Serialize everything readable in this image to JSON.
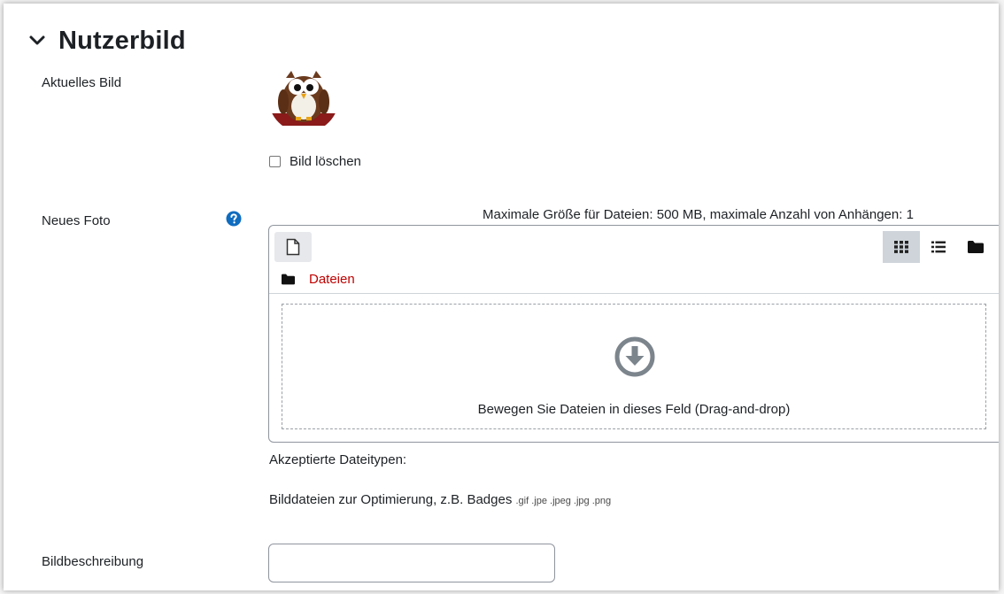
{
  "section": {
    "title": "Nutzerbild"
  },
  "current_image": {
    "label": "Aktuelles Bild",
    "avatar_icon": "owl-avatar-icon",
    "delete_checkbox_label": "Bild löschen",
    "delete_checked": false
  },
  "new_photo": {
    "label": "Neues Foto",
    "help_icon": "question-circle-icon",
    "max_size_text": "Maximale Größe für Dateien: 500 MB, maximale Anzahl von Anhängen: 1",
    "toolbar": {
      "add_file_icon": "file-icon",
      "views": [
        {
          "icon": "grid-icon",
          "active": true
        },
        {
          "icon": "list-icon",
          "active": false
        },
        {
          "icon": "folder-icon",
          "active": false
        }
      ]
    },
    "breadcrumb": {
      "icon": "folder-icon",
      "label": "Dateien"
    },
    "dropzone": {
      "icon": "arrow-circle-down-icon",
      "text": "Bewegen Sie Dateien in dieses Feld (Drag-and-drop)"
    },
    "accepted_title": "Akzeptierte Dateitypen:",
    "accepted_desc": "Bilddateien zur Optimierung, z.B. Badges",
    "accepted_types": ".gif .jpe .jpeg .jpg .png"
  },
  "image_description": {
    "label": "Bildbeschreibung",
    "value": "",
    "placeholder": ""
  },
  "colors": {
    "text": "#1d2125",
    "link_red": "#c00000",
    "help_blue": "#0f6cbf",
    "border": "#8f959e"
  }
}
